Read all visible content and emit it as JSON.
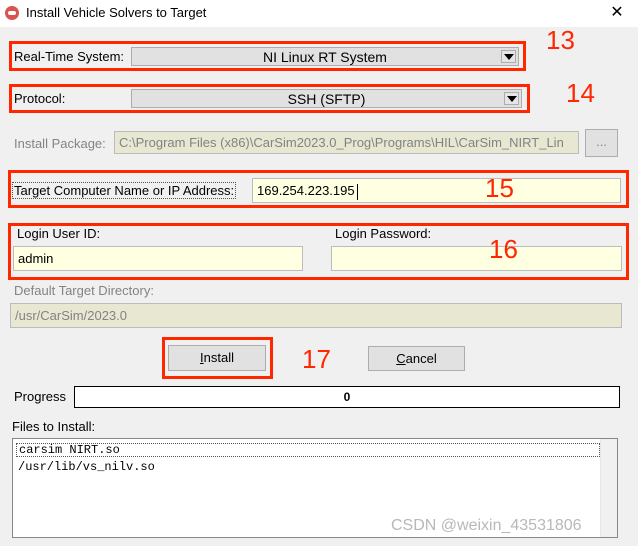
{
  "window": {
    "title": "Install Vehicle Solvers to Target",
    "close_glyph": "✕"
  },
  "realtime": {
    "label": "Real-Time System:",
    "value": "NI Linux RT System",
    "marker": "13"
  },
  "protocol": {
    "label": "Protocol:",
    "value": "SSH (SFTP)",
    "marker": "14"
  },
  "install_package": {
    "label": "Install Package:",
    "value": "C:\\Program Files (x86)\\CarSim2023.0_Prog\\Programs\\HIL\\CarSim_NIRT_Lin",
    "browse": "..."
  },
  "target": {
    "label": "Target Computer Name or IP Address:",
    "value": "169.254.223.195",
    "marker": "15"
  },
  "login": {
    "user_label": "Login User ID:",
    "user_value": "admin",
    "password_label": "Login Password:",
    "password_value": "",
    "marker": "16"
  },
  "directory": {
    "label": "Default Target Directory:",
    "value": "/usr/CarSim/2023.0"
  },
  "buttons": {
    "install_pre": "",
    "install_u": "I",
    "install_post": "nstall",
    "cancel_pre": "",
    "cancel_u": "C",
    "cancel_post": "ancel",
    "marker": "17"
  },
  "progress": {
    "label": "Progress",
    "value": "0"
  },
  "files": {
    "label": "Files to Install:",
    "items": [
      "carsim NIRT.so",
      "/usr/lib/vs_nilv.so"
    ]
  },
  "watermark": "CSDN @weixin_43531806",
  "colors": {
    "annotation": "#ff2600",
    "field_yellow": "#ffffe1",
    "disabled_field": "#e7e7d2"
  }
}
